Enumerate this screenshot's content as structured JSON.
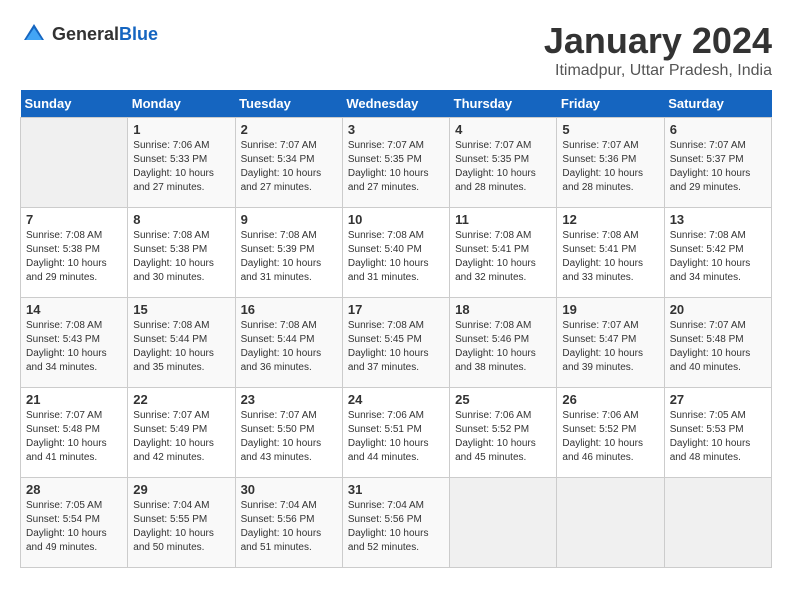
{
  "header": {
    "logo_general": "General",
    "logo_blue": "Blue",
    "month": "January 2024",
    "location": "Itimadpur, Uttar Pradesh, India"
  },
  "days_of_week": [
    "Sunday",
    "Monday",
    "Tuesday",
    "Wednesday",
    "Thursday",
    "Friday",
    "Saturday"
  ],
  "weeks": [
    [
      {
        "day": "",
        "info": ""
      },
      {
        "day": "1",
        "info": "Sunrise: 7:06 AM\nSunset: 5:33 PM\nDaylight: 10 hours\nand 27 minutes."
      },
      {
        "day": "2",
        "info": "Sunrise: 7:07 AM\nSunset: 5:34 PM\nDaylight: 10 hours\nand 27 minutes."
      },
      {
        "day": "3",
        "info": "Sunrise: 7:07 AM\nSunset: 5:35 PM\nDaylight: 10 hours\nand 27 minutes."
      },
      {
        "day": "4",
        "info": "Sunrise: 7:07 AM\nSunset: 5:35 PM\nDaylight: 10 hours\nand 28 minutes."
      },
      {
        "day": "5",
        "info": "Sunrise: 7:07 AM\nSunset: 5:36 PM\nDaylight: 10 hours\nand 28 minutes."
      },
      {
        "day": "6",
        "info": "Sunrise: 7:07 AM\nSunset: 5:37 PM\nDaylight: 10 hours\nand 29 minutes."
      }
    ],
    [
      {
        "day": "7",
        "info": "Sunrise: 7:08 AM\nSunset: 5:38 PM\nDaylight: 10 hours\nand 29 minutes."
      },
      {
        "day": "8",
        "info": "Sunrise: 7:08 AM\nSunset: 5:38 PM\nDaylight: 10 hours\nand 30 minutes."
      },
      {
        "day": "9",
        "info": "Sunrise: 7:08 AM\nSunset: 5:39 PM\nDaylight: 10 hours\nand 31 minutes."
      },
      {
        "day": "10",
        "info": "Sunrise: 7:08 AM\nSunset: 5:40 PM\nDaylight: 10 hours\nand 31 minutes."
      },
      {
        "day": "11",
        "info": "Sunrise: 7:08 AM\nSunset: 5:41 PM\nDaylight: 10 hours\nand 32 minutes."
      },
      {
        "day": "12",
        "info": "Sunrise: 7:08 AM\nSunset: 5:41 PM\nDaylight: 10 hours\nand 33 minutes."
      },
      {
        "day": "13",
        "info": "Sunrise: 7:08 AM\nSunset: 5:42 PM\nDaylight: 10 hours\nand 34 minutes."
      }
    ],
    [
      {
        "day": "14",
        "info": "Sunrise: 7:08 AM\nSunset: 5:43 PM\nDaylight: 10 hours\nand 34 minutes."
      },
      {
        "day": "15",
        "info": "Sunrise: 7:08 AM\nSunset: 5:44 PM\nDaylight: 10 hours\nand 35 minutes."
      },
      {
        "day": "16",
        "info": "Sunrise: 7:08 AM\nSunset: 5:44 PM\nDaylight: 10 hours\nand 36 minutes."
      },
      {
        "day": "17",
        "info": "Sunrise: 7:08 AM\nSunset: 5:45 PM\nDaylight: 10 hours\nand 37 minutes."
      },
      {
        "day": "18",
        "info": "Sunrise: 7:08 AM\nSunset: 5:46 PM\nDaylight: 10 hours\nand 38 minutes."
      },
      {
        "day": "19",
        "info": "Sunrise: 7:07 AM\nSunset: 5:47 PM\nDaylight: 10 hours\nand 39 minutes."
      },
      {
        "day": "20",
        "info": "Sunrise: 7:07 AM\nSunset: 5:48 PM\nDaylight: 10 hours\nand 40 minutes."
      }
    ],
    [
      {
        "day": "21",
        "info": "Sunrise: 7:07 AM\nSunset: 5:48 PM\nDaylight: 10 hours\nand 41 minutes."
      },
      {
        "day": "22",
        "info": "Sunrise: 7:07 AM\nSunset: 5:49 PM\nDaylight: 10 hours\nand 42 minutes."
      },
      {
        "day": "23",
        "info": "Sunrise: 7:07 AM\nSunset: 5:50 PM\nDaylight: 10 hours\nand 43 minutes."
      },
      {
        "day": "24",
        "info": "Sunrise: 7:06 AM\nSunset: 5:51 PM\nDaylight: 10 hours\nand 44 minutes."
      },
      {
        "day": "25",
        "info": "Sunrise: 7:06 AM\nSunset: 5:52 PM\nDaylight: 10 hours\nand 45 minutes."
      },
      {
        "day": "26",
        "info": "Sunrise: 7:06 AM\nSunset: 5:52 PM\nDaylight: 10 hours\nand 46 minutes."
      },
      {
        "day": "27",
        "info": "Sunrise: 7:05 AM\nSunset: 5:53 PM\nDaylight: 10 hours\nand 48 minutes."
      }
    ],
    [
      {
        "day": "28",
        "info": "Sunrise: 7:05 AM\nSunset: 5:54 PM\nDaylight: 10 hours\nand 49 minutes."
      },
      {
        "day": "29",
        "info": "Sunrise: 7:04 AM\nSunset: 5:55 PM\nDaylight: 10 hours\nand 50 minutes."
      },
      {
        "day": "30",
        "info": "Sunrise: 7:04 AM\nSunset: 5:56 PM\nDaylight: 10 hours\nand 51 minutes."
      },
      {
        "day": "31",
        "info": "Sunrise: 7:04 AM\nSunset: 5:56 PM\nDaylight: 10 hours\nand 52 minutes."
      },
      {
        "day": "",
        "info": ""
      },
      {
        "day": "",
        "info": ""
      },
      {
        "day": "",
        "info": ""
      }
    ]
  ]
}
